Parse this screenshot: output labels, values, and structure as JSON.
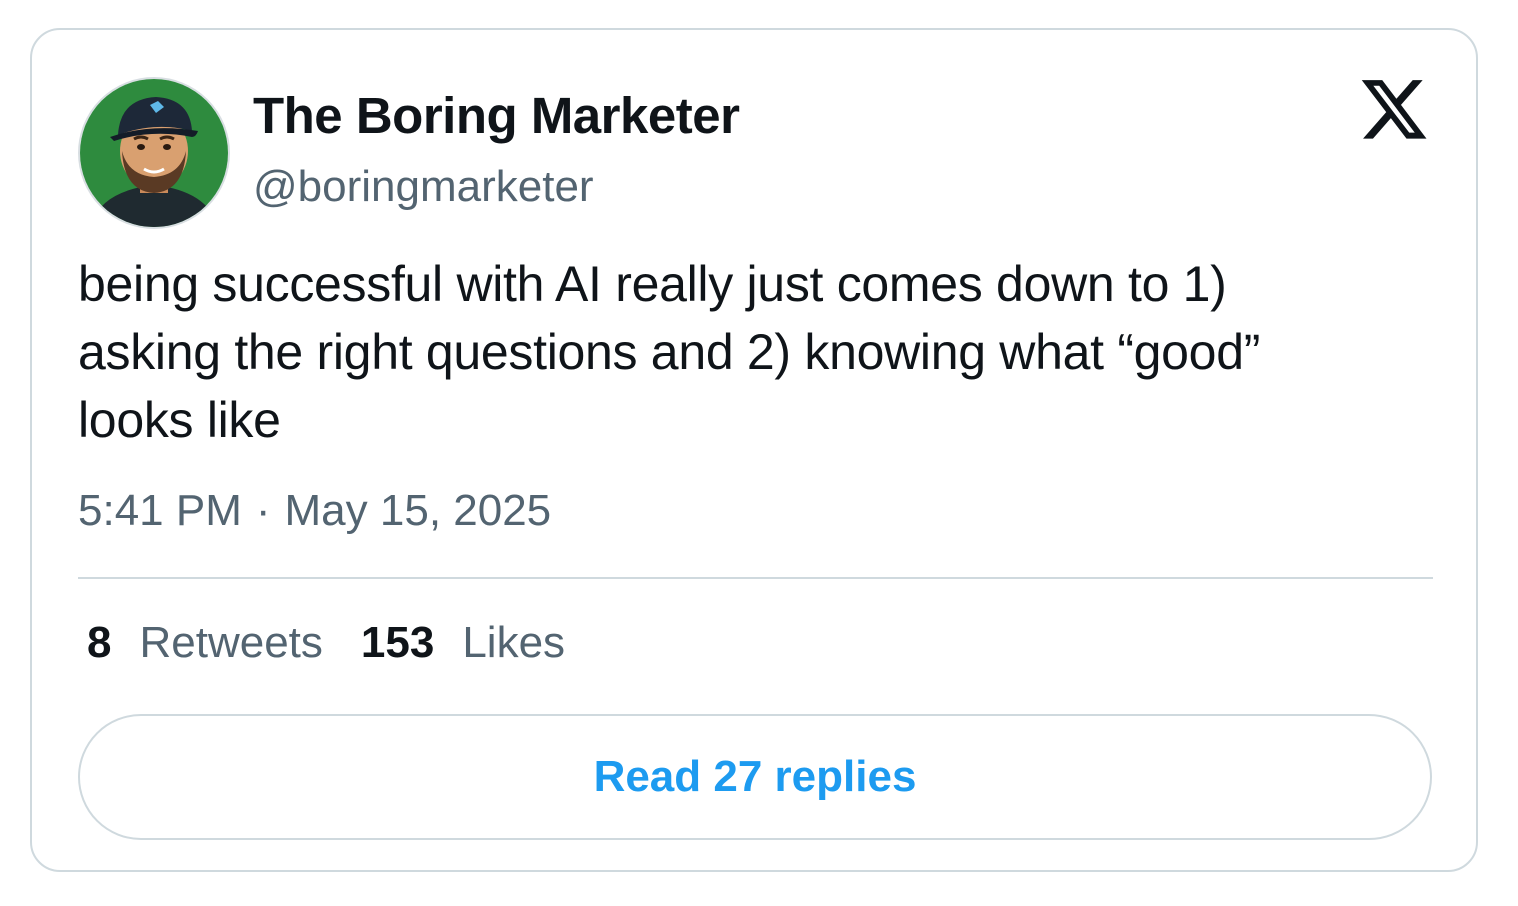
{
  "author": {
    "display_name": "The Boring Marketer",
    "handle": "@boringmarketer"
  },
  "platform_icon": "x-logo-icon",
  "avatar_icon": "avatar-illustration",
  "tweet": {
    "lines": [
      "being successful with AI really just comes down to 1)",
      "asking the right questions and 2) knowing what “good”",
      "looks like"
    ],
    "time": "5:41 PM",
    "separator": "·",
    "date": "May 15, 2025"
  },
  "stats": {
    "retweets_count": "8",
    "retweets_label": "Retweets",
    "likes_count": "153",
    "likes_label": "Likes"
  },
  "actions": {
    "read_replies_label": "Read 27 replies"
  },
  "colors": {
    "text_primary": "#0f1419",
    "text_secondary": "#536471",
    "accent": "#1d9bf0",
    "border": "#cfd9de"
  }
}
